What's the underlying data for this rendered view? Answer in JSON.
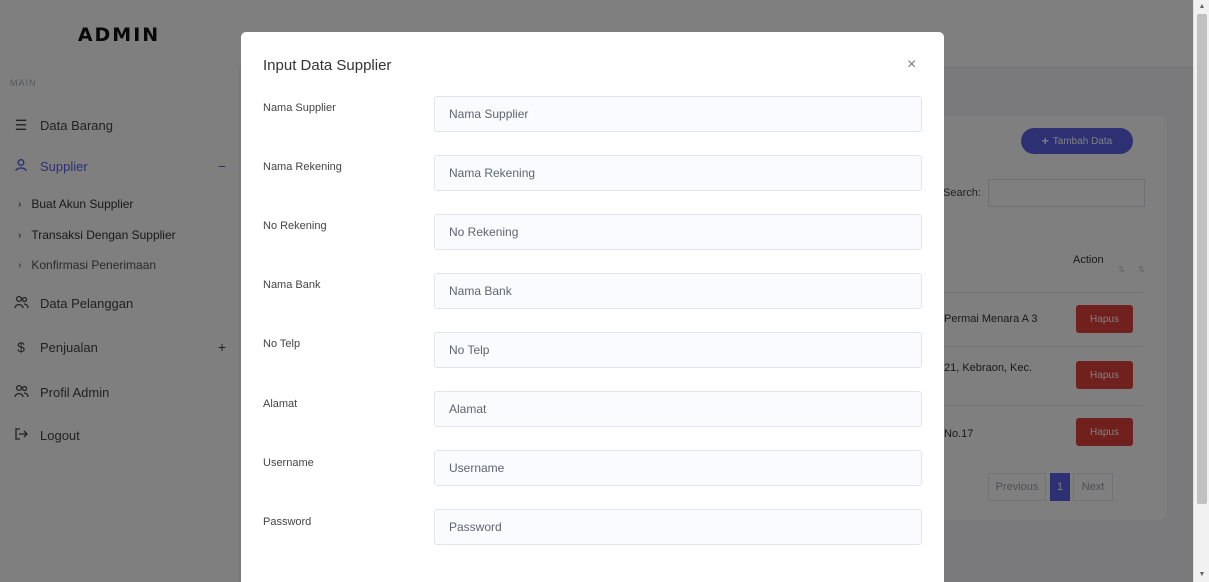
{
  "sidebar": {
    "brand": "ADMIN",
    "section": "MAIN",
    "items": [
      {
        "label": "Data Barang",
        "icon": "list-icon"
      },
      {
        "label": "Supplier",
        "icon": "user-icon",
        "toggle": "−",
        "active": true
      },
      {
        "label": "Data Pelanggan",
        "icon": "users-icon"
      },
      {
        "label": "Penjualan",
        "icon": "dollar-icon",
        "toggle": "+"
      },
      {
        "label": "Profil Admin",
        "icon": "users-icon"
      },
      {
        "label": "Logout",
        "icon": "logout-icon"
      }
    ],
    "subitems": [
      "Buat Akun Supplier",
      "Transaksi Dengan Supplier",
      "Konfirmasi Penerimaan"
    ]
  },
  "background": {
    "add_button": "Tambah Data",
    "search_label": "Search:",
    "column_action": "Action",
    "rows": [
      {
        "address": "Permai Menara A 3",
        "action": "Hapus"
      },
      {
        "address": "21, Kebraon, Kec.",
        "action": "Hapus"
      },
      {
        "address": "No.17",
        "action": "Hapus"
      }
    ],
    "pagination": {
      "previous": "Previous",
      "current": "1",
      "next": "Next"
    }
  },
  "modal": {
    "title": "Input Data Supplier",
    "close": "×",
    "fields": [
      {
        "label": "Nama Supplier",
        "placeholder": "Nama Supplier"
      },
      {
        "label": "Nama Rekening",
        "placeholder": "Nama Rekening"
      },
      {
        "label": "No Rekening",
        "placeholder": "No Rekening"
      },
      {
        "label": "Nama Bank",
        "placeholder": "Nama Bank"
      },
      {
        "label": "No Telp",
        "placeholder": "No Telp"
      },
      {
        "label": "Alamat",
        "placeholder": "Alamat"
      },
      {
        "label": "Username",
        "placeholder": "Username"
      },
      {
        "label": "Password",
        "placeholder": "Password"
      }
    ]
  },
  "colors": {
    "accent": "#5b63e8",
    "danger": "#e0413a"
  }
}
